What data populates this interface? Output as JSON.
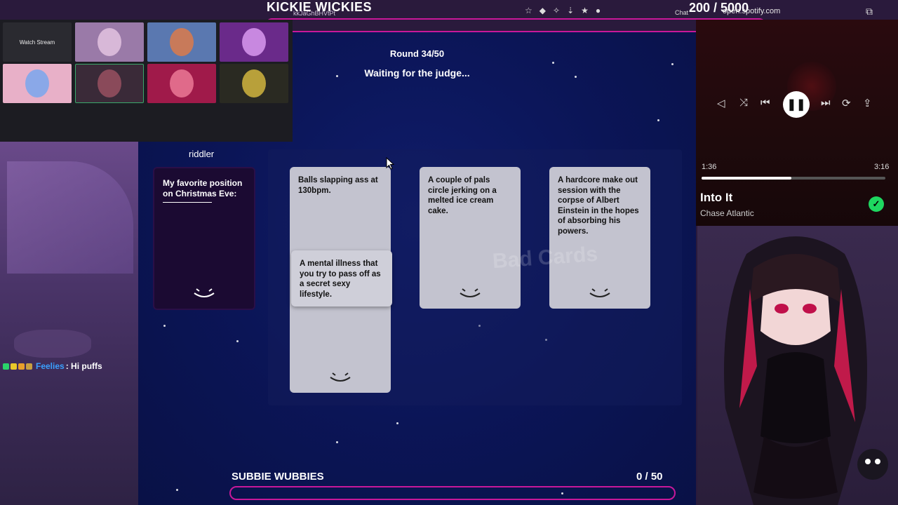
{
  "overlay": {
    "title": "KICKIE WICKIES",
    "subtitle": "kkJaGhBHVtPt",
    "counter": "200 / 5000",
    "url": "open.spotify.com",
    "chat_tab": "Chat"
  },
  "grid": {
    "watch_label": "Watch Stream",
    "avatar_colors": [
      "#b48ab4",
      "#4a6aa8",
      "#7a3aa0",
      "#e0a8c0",
      "#5a3a4a",
      "#a8285a",
      "#3a3a2a"
    ]
  },
  "game": {
    "round": "Round 34/50",
    "status": "Waiting for the judge...",
    "player": "riddler",
    "black_card": "My favorite position on Christmas Eve:",
    "white_cards": [
      "Balls slapping ass at 130bpm.",
      "A mental illness that you try to pass off as a secret sexy lifestyle.",
      "A couple of pals circle jerking on a melted ice cream cake.",
      "A hardcore make out session with the corpse of Albert Einstein in the hopes of absorbing his powers."
    ],
    "watermark": "Bad Cards",
    "bottom_title": "SUBBIE WUBBIES",
    "bottom_score": "0  / 50"
  },
  "chat": {
    "user": "Feelies",
    "message": ": Hi puffs"
  },
  "spotify": {
    "elapsed": "1:36",
    "duration": "3:16",
    "progress": 0.49,
    "track": "Into It",
    "artist": "Chase Atlantic"
  },
  "colors": {
    "accent_pink": "#c8189a",
    "spotify_green": "#1ed760",
    "card_white": "#c3c3cf",
    "card_black": "#1b0a32"
  }
}
